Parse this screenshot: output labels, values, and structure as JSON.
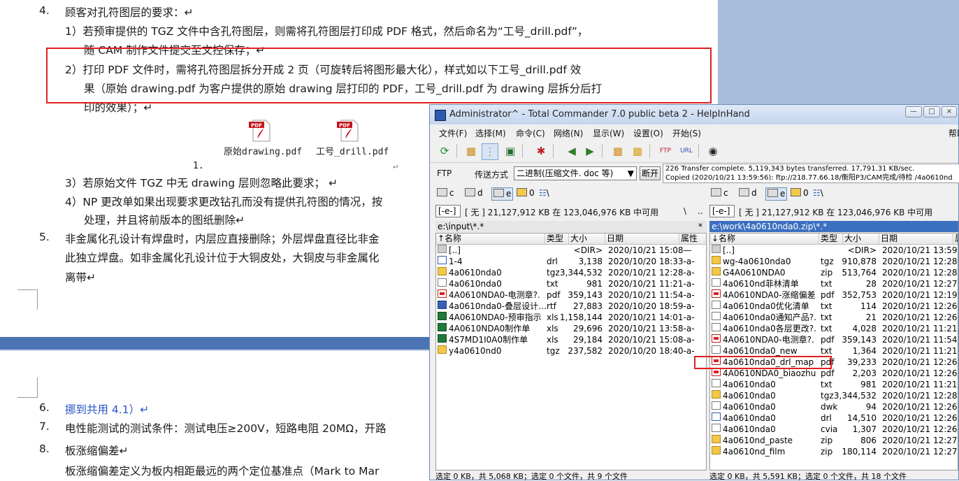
{
  "doc": {
    "item4": "4.",
    "item4_text": "顾客对孔符图层的要求：↵",
    "item4_1": "1）若预审提供的 TGZ 文件中含孔符图层，则需将孔符图层打印成 PDF 格式，然后命名为“工号_drill.pdf”，",
    "item4_1b": "随 CAM 制作文件提交至文控保存；↵",
    "item4_2": "2）打印 PDF 文件时，需将孔符图层拆分开成 2 页（可旋转后将图形最大化），样式如以下工号_drill.pdf 效",
    "item4_2b": "果（原始 drawing.pdf 为客户提供的原始 drawing 层打印的 PDF，工号_drill.pdf 为 drawing 层拆分后打",
    "item4_2c": "印的效果）；↵",
    "pdf1_label": "原始drawing.pdf",
    "pdf2_label": "工号_drill.pdf",
    "pdf_badge": "PDF",
    "list_num": "1.",
    "arrow_mark": "↵",
    "item4_3": "3）若原始文件 TGZ 中无 drawing 层则忽略此要求；  ↵",
    "item4_4": "4）NP 更改单如果出现要求更改钻孔而没有提供孔符图的情况，按",
    "item4_4b": "处理，并且将前版本的图纸删除↵",
    "item5": "5.",
    "item5_text": "非金属化孔设计有焊盘时，内层应直接删除；外层焊盘直径比非金",
    "item5_b": "此独立焊盘。如非金属化孔设计位于大铜皮处，大铜皮与非金属化",
    "item5_c": "离带↵",
    "item6": "6.",
    "item6_text": "挪到共用 4.1）↵",
    "item7": "7.",
    "item7_text": "电性能测试的测试条件：测试电压≥200V，短路电阻 20MΩ，开路",
    "item8": "8.",
    "item8_text": "板涨缩偏差↵",
    "item8_b": "板涨缩偏差定义为板内相距最远的两个定位基准点（Mark  to  Mar"
  },
  "tc": {
    "title": "Administrator^ - Total Commander 7.0 public beta 2 - HelpInHand",
    "menu": [
      "文件(F)",
      "选择(M)",
      "命令(C)",
      "网络(N)",
      "显示(W)",
      "设置(O)",
      "开始(S)"
    ],
    "menu_right": "帮助",
    "ftp_label": "FTP",
    "transfer_label": "传送方式",
    "transfer_mode": "二进制(压缩文件. doc 等)",
    "disconnect": "断开",
    "log_line1": "226 Transfer complete. 5,119,343 bytes transferred. 17,791.31 KB/sec.",
    "log_line2": "Copied (2020/10/21 13:59:56): ftp://218.77.66.18/衡阳P3/CAM完成/待检 /4a0610nd",
    "drives": [
      "c",
      "d",
      "e",
      "0",
      "\\"
    ],
    "left": {
      "drive_combo": "[-e-]",
      "free": "[ 无 ]  21,127,912 KB 在 123,046,976 KB 中可用",
      "path_btns": [
        "\\",
        ".."
      ],
      "path": "e:\\input\\*.*",
      "star": "*",
      "headers": [
        "↑名称",
        "类型",
        "大小",
        "日期",
        "属性"
      ],
      "rows": [
        {
          "icon": "up",
          "name": "[..]",
          "ext": "",
          "size": "<DIR>",
          "date": "2020/10/21 15:08—"
        },
        {
          "icon": "drl",
          "name": "1-4",
          "ext": "drl",
          "size": "3,138",
          "date": "2020/10/20 18:33-a-"
        },
        {
          "icon": "folder",
          "name": "4a0610nda0",
          "ext": "tgz",
          "size": "3,344,532",
          "date": "2020/10/21 12:28-a-"
        },
        {
          "icon": "file",
          "name": "4a0610nda0",
          "ext": "txt",
          "size": "981",
          "date": "2020/10/21 11:21-a-"
        },
        {
          "icon": "pdf",
          "name": "4A0610NDA0-电测章?.",
          "ext": "pdf",
          "size": "359,143",
          "date": "2020/10/21 11:54-a-"
        },
        {
          "icon": "rtf",
          "name": "4a0610nda0-叠层设计…",
          "ext": "rtf",
          "size": "27,883",
          "date": "2020/10/20 18:59-a-"
        },
        {
          "icon": "xls",
          "name": "4A0610NDA0-预审指示",
          "ext": "xls",
          "size": "1,158,144",
          "date": "2020/10/21 14:01-a-"
        },
        {
          "icon": "xls",
          "name": "4A0610NDA0制作单",
          "ext": "xls",
          "size": "29,696",
          "date": "2020/10/21 13:58-a-"
        },
        {
          "icon": "xls",
          "name": "4S7MD1I0A0制作单",
          "ext": "xls",
          "size": "29,184",
          "date": "2020/10/21 15:08-a-"
        },
        {
          "icon": "folder",
          "name": "y4a0610nd0",
          "ext": "tgz",
          "size": "237,582",
          "date": "2020/10/20 18:40-a-"
        }
      ],
      "status": "选定 0 KB，共 5,068 KB；选定 0 个文件，共 9 个文件"
    },
    "right": {
      "drive_combo": "[-e-]",
      "free": "[ 无 ]  21,127,912 KB 在 123,046,976 KB 中可用",
      "path": "e:\\work\\4a0610nda0.zip\\*.*",
      "headers": [
        "↓名称",
        "类型",
        "大小",
        "日期",
        "属性"
      ],
      "rows": [
        {
          "icon": "up",
          "name": "[..]",
          "ext": "",
          "size": "<DIR>",
          "date": "2020/10/21 13:59"
        },
        {
          "icon": "zip",
          "name": "wg-4a0610nda0",
          "ext": "tgz",
          "size": "910,878",
          "date": "2020/10/21 12:28"
        },
        {
          "icon": "zip",
          "name": "G4A0610NDA0",
          "ext": "zip",
          "size": "513,764",
          "date": "2020/10/21 12:28"
        },
        {
          "icon": "file",
          "name": "4a0610nd菲林清单",
          "ext": "txt",
          "size": "28",
          "date": "2020/10/21 12:27"
        },
        {
          "icon": "pdf",
          "name": "4A0610NDA0-涨缩偏差",
          "ext": "pdf",
          "size": "352,753",
          "date": "2020/10/21 12:19"
        },
        {
          "icon": "file",
          "name": "4a0610nda0优化清单",
          "ext": "txt",
          "size": "114",
          "date": "2020/10/21 12:26"
        },
        {
          "icon": "file",
          "name": "4a0610nda0通知产品?.",
          "ext": "txt",
          "size": "21",
          "date": "2020/10/21 12:26"
        },
        {
          "icon": "file",
          "name": "4a0610nda0各层更改?.",
          "ext": "txt",
          "size": "4,028",
          "date": "2020/10/21 11:21"
        },
        {
          "icon": "pdf",
          "name": "4A0610NDA0-电测章?.",
          "ext": "pdf",
          "size": "359,143",
          "date": "2020/10/21 11:54"
        },
        {
          "icon": "file",
          "name": "4a0610nda0_new",
          "ext": "txt",
          "size": "1,364",
          "date": "2020/10/21 11:21"
        },
        {
          "icon": "pdf",
          "name": "4a0610nda0_drl_map",
          "ext": "pdf",
          "size": "39,233",
          "date": "2020/10/21 12:26"
        },
        {
          "icon": "pdf",
          "name": "4A0610NDA0_biaozhu",
          "ext": "pdf",
          "size": "2,203",
          "date": "2020/10/21 12:26"
        },
        {
          "icon": "file",
          "name": "4a0610nda0",
          "ext": "txt",
          "size": "981",
          "date": "2020/10/21 11:21"
        },
        {
          "icon": "zip",
          "name": "4a0610nda0",
          "ext": "tgz",
          "size": "3,344,532",
          "date": "2020/10/21 12:28"
        },
        {
          "icon": "file",
          "name": "4a0610nda0",
          "ext": "dwk",
          "size": "94",
          "date": "2020/10/21 12:26"
        },
        {
          "icon": "drl",
          "name": "4a0610nda0",
          "ext": "drl",
          "size": "14,510",
          "date": "2020/10/21 12:26"
        },
        {
          "icon": "file",
          "name": "4a0610nda0",
          "ext": "cvia",
          "size": "1,307",
          "date": "2020/10/21 12:26"
        },
        {
          "icon": "zip",
          "name": "4a0610nd_paste",
          "ext": "zip",
          "size": "806",
          "date": "2020/10/21 12:27"
        },
        {
          "icon": "zip",
          "name": "4a0610nd_film",
          "ext": "zip",
          "size": "180,114",
          "date": "2020/10/21 12:27"
        }
      ],
      "status": "选定 0 KB，共 5,591 KB；选定 0 个文件，共 18 个文件"
    }
  },
  "colors": {
    "highlight_red": "#e02020",
    "title_bar": "#c4d5ee",
    "link_blue": "#2b55c4"
  }
}
